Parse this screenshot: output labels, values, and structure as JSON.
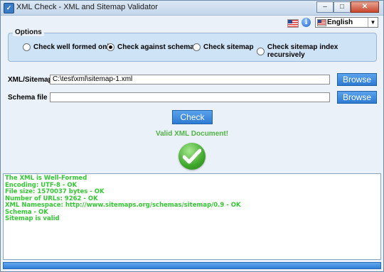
{
  "window": {
    "title": "XML Check - XML and Sitemap Validator",
    "icon": "xml-check-app-icon",
    "controls": {
      "minimize": "–",
      "maximize": "□",
      "close": "✕"
    }
  },
  "language": {
    "selected": "English"
  },
  "options": {
    "legend": "Options",
    "radios": [
      {
        "label": "Check well formed only",
        "checked": false
      },
      {
        "label": "Check against schema",
        "checked": true
      },
      {
        "label": "Check sitemap",
        "checked": false
      },
      {
        "label": "Check sitemap index recursively",
        "checked": false
      }
    ]
  },
  "fields": {
    "xml_label": "XML/Sitemap",
    "xml_value": "C:\\test\\xml\\sitemap-1.xml",
    "schema_label": "Schema file",
    "schema_value": "",
    "browse_label": "Browse"
  },
  "check_button": "Check",
  "result_message": "Valid XML Document!",
  "log_lines": [
    "The XML is Well-Formed",
    "Encoding: UTF-8 - OK",
    "File size: 1570037 bytes - OK",
    "Number of URLs: 9262 - OK",
    "XML Namespace: http://www.sitemaps.org/schemas/sitemap/0.9 - OK",
    "Schema - OK",
    "Sitemap is valid"
  ],
  "colors": {
    "accent_blue": "#2d7bd3",
    "success_green": "#4fb346",
    "log_text": "#32c832"
  }
}
